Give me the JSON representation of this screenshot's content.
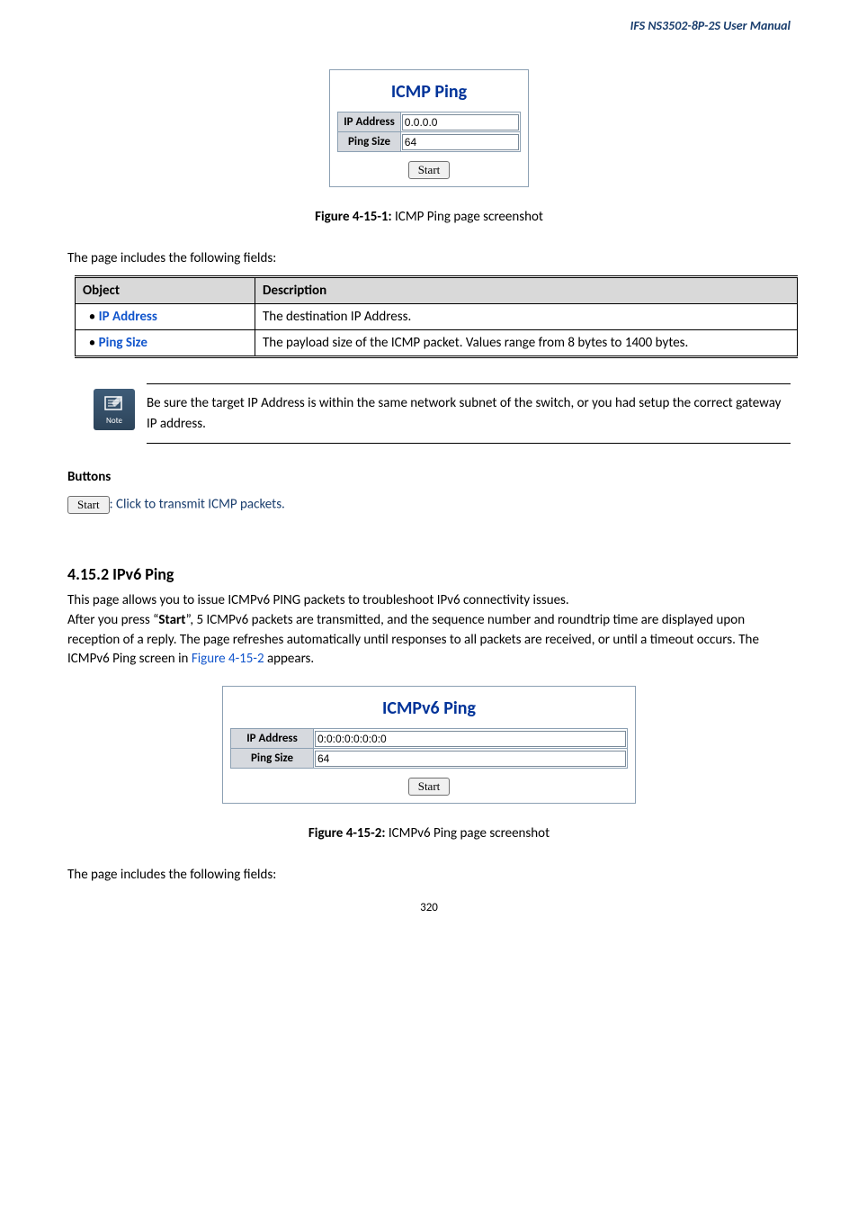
{
  "header": "IFS  NS3502-8P-2S  User  Manual",
  "panel1": {
    "title": "ICMP Ping",
    "ip_label": "IP Address",
    "ip_value": "0.0.0.0",
    "size_label": "Ping Size",
    "size_value": "64",
    "start_label": "Start"
  },
  "figcap1_bold": "Figure 4-15-1:",
  "figcap1_rest": " ICMP Ping page screenshot",
  "intro1": "The page includes the following fields:",
  "table1": {
    "col1": "Object",
    "col2": "Description",
    "rows": [
      {
        "obj": "IP Address",
        "desc": "The destination IP Address."
      },
      {
        "obj": "Ping Size",
        "desc": "The payload size of the ICMP packet. Values range from 8 bytes to 1400 bytes."
      }
    ]
  },
  "note": {
    "label": "Note",
    "text": "Be sure the target IP Address is within the same network subnet of the switch, or you had setup the correct gateway IP address."
  },
  "buttons": {
    "heading": "Buttons",
    "start_label": "Start",
    "desc": ": Click to transmit ICMP packets."
  },
  "section": {
    "heading": "4.15.2 IPv6 Ping",
    "line1": "This page allows you to issue ICMPv6 PING packets to troubleshoot IPv6 connectivity issues.",
    "line2a": "After you press “",
    "line2b_bold": "Start",
    "line2c": "”, 5 ICMPv6 packets are transmitted, and the sequence number and roundtrip time are displayed upon reception of a reply. The page refreshes automatically until responses to all packets are received, or until a timeout occurs. The ICMPv6 Ping screen in ",
    "line2d_link": "Figure 4-15-2",
    "line2e": " appears."
  },
  "panel2": {
    "title": "ICMPv6 Ping",
    "ip_label": "IP Address",
    "ip_value": "0:0:0:0:0:0:0:0",
    "size_label": "Ping Size",
    "size_value": "64",
    "start_label": "Start"
  },
  "figcap2_bold": "Figure 4-15-2:",
  "figcap2_rest": " ICMPv6 Ping page screenshot",
  "intro2": "The page includes the following fields:",
  "page_number": "320"
}
